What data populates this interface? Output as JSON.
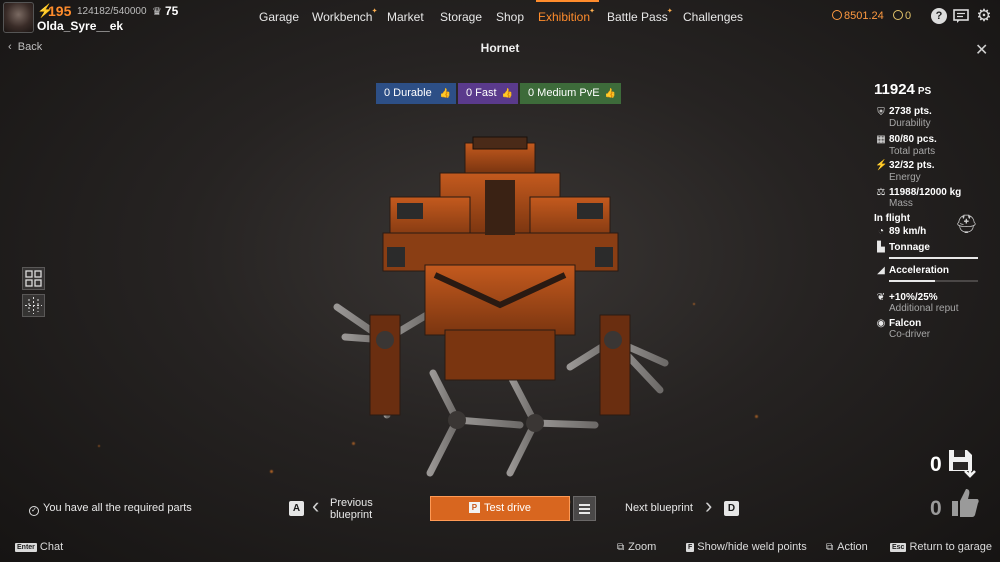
{
  "player": {
    "level": "195",
    "xp": "124182/540000",
    "rank": "75",
    "username": "Olda_Syre__ek"
  },
  "nav": {
    "items": [
      {
        "label": "Garage"
      },
      {
        "label": "Workbench",
        "dot": true
      },
      {
        "label": "Market"
      },
      {
        "label": "Storage"
      },
      {
        "label": "Shop"
      },
      {
        "label": "Exhibition",
        "dot": true,
        "active": true
      },
      {
        "label": "Battle Pass",
        "dot": true
      },
      {
        "label": "Challenges"
      }
    ]
  },
  "currency": {
    "coins": "8501.24",
    "badges": "0"
  },
  "header": {
    "back": "Back",
    "title": "Hornet"
  },
  "tags": [
    {
      "label": "0 Durable"
    },
    {
      "label": "0 Fast"
    },
    {
      "label": "0 Medium PvE"
    }
  ],
  "stats": {
    "ps_value": "11924",
    "ps_unit": "PS",
    "durability_value": "2738 pts.",
    "durability_label": "Durability",
    "parts_value": "80/80 pcs.",
    "parts_label": "Total parts",
    "energy_value": "32/32 pts.",
    "energy_label": "Energy",
    "mass_value": "11988/12000 kg",
    "mass_label": "Mass",
    "in_flight_label": "In flight",
    "speed_value": "89 km/h",
    "tonnage_label": "Tonnage",
    "tonnage_fill": 1.0,
    "acceleration_label": "Acceleration",
    "acceleration_fill": 0.52,
    "reputation_value": "+10%/25%",
    "reputation_label": "Additional reput",
    "codriver_value": "Falcon",
    "codriver_label": "Co-driver"
  },
  "bottom": {
    "required_parts": "You have all the required parts",
    "prev_key": "A",
    "prev_line1": "Previous",
    "prev_line2": "blueprint",
    "test_key": "P",
    "test_drive": "Test drive",
    "next_label": "Next blueprint",
    "next_key": "D",
    "saves_count": "0",
    "likes_count": "0"
  },
  "hints": {
    "chat_key": "Enter",
    "chat": "Chat",
    "zoom": "Zoom",
    "weld_key": "F",
    "weld": "Show/hide weld points",
    "action": "Action",
    "return_key": "Esc",
    "return": "Return to garage"
  },
  "colors": {
    "accent": "#ff8c2c",
    "durable_tag": "#2d4f86",
    "fast_tag": "#5a3a8c",
    "pve_tag": "#3d6b3a",
    "test_button": "#d8661f"
  }
}
